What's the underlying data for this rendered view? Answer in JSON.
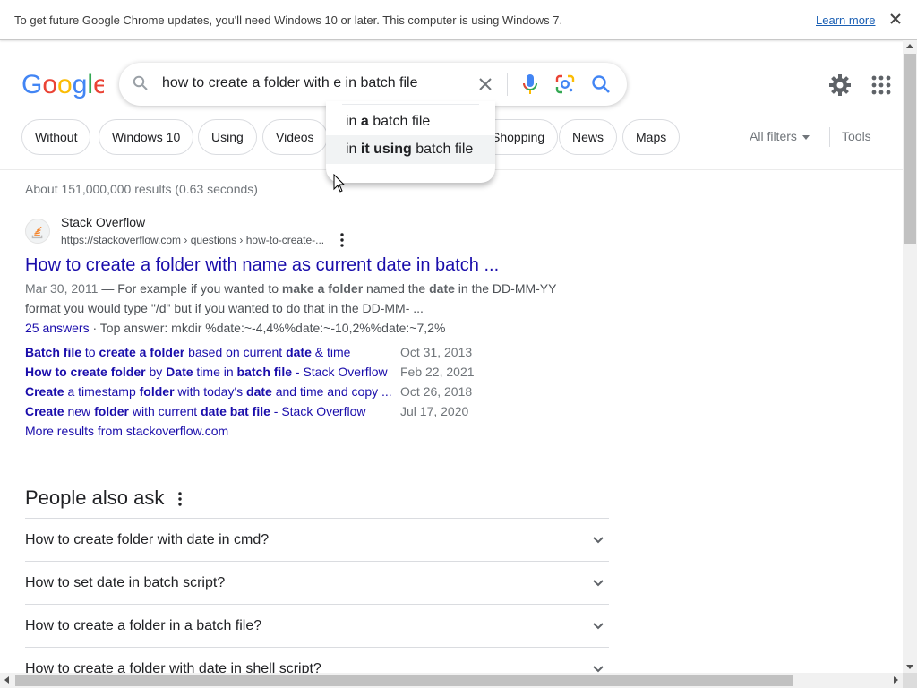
{
  "infobar": {
    "message": "To get future Google Chrome updates, you'll need Windows 10 or later. This computer is using Windows 7.",
    "learn_more": "Learn more"
  },
  "search": {
    "query": "how to create a folder with e in batch file"
  },
  "suggestions": [
    {
      "pre": "in ",
      "bold": "a",
      "post": " batch file"
    },
    {
      "pre": "in ",
      "bold": "it using",
      "post": " batch file"
    }
  ],
  "chips": [
    "Without",
    "Windows 10",
    "Using",
    "Videos",
    "Shopping",
    "News",
    "Maps"
  ],
  "filters": {
    "all_filters": "All filters",
    "tools": "Tools"
  },
  "stats": "About 151,000,000 results (0.63 seconds)",
  "result": {
    "site_name": "Stack Overflow",
    "url": "https://stackoverflow.com › questions › how-to-create-...",
    "title": "How to create a folder with name as current date in batch ...",
    "snippet_line1": {
      "date": "Mar 30, 2011",
      "pre": " — For example if you wanted to ",
      "b1": "make a folder",
      "mid": " named the ",
      "b2": "date",
      "post": " in the DD-MM-YY"
    },
    "snippet_line2": "format you would type \"/d\" but if you wanted to do that in the DD-MM- ...",
    "answers_link": "25 answers",
    "top_answer": " · Top answer: mkdir %date:~-4,4%%date:~-10,2%%date:~7,2%",
    "sublinks": [
      {
        "parts": [
          {
            "t": "Batch file",
            "b": true
          },
          {
            "t": " to ",
            "b": false
          },
          {
            "t": "create a folder",
            "b": true
          },
          {
            "t": " based on current ",
            "b": false
          },
          {
            "t": "date",
            "b": true
          },
          {
            "t": " & time",
            "b": false
          }
        ],
        "date": "Oct 31, 2013"
      },
      {
        "parts": [
          {
            "t": "How to create folder",
            "b": true
          },
          {
            "t": " by ",
            "b": false
          },
          {
            "t": "Date",
            "b": true
          },
          {
            "t": " time in ",
            "b": false
          },
          {
            "t": "batch file",
            "b": true
          },
          {
            "t": " - Stack Overflow",
            "b": false
          }
        ],
        "date": "Feb 22, 2021"
      },
      {
        "parts": [
          {
            "t": "Create",
            "b": true
          },
          {
            "t": " a timestamp ",
            "b": false
          },
          {
            "t": "folder",
            "b": true
          },
          {
            "t": " with today's ",
            "b": false
          },
          {
            "t": "date",
            "b": true
          },
          {
            "t": " and time and copy ...",
            "b": false
          }
        ],
        "date": "Oct 26, 2018"
      },
      {
        "parts": [
          {
            "t": "Create",
            "b": true
          },
          {
            "t": " new ",
            "b": false
          },
          {
            "t": "folder",
            "b": true
          },
          {
            "t": " with current ",
            "b": false
          },
          {
            "t": "date bat file",
            "b": true
          },
          {
            "t": " - Stack Overflow",
            "b": false
          }
        ],
        "date": "Jul 17, 2020"
      }
    ],
    "more_results": "More results from stackoverflow.com"
  },
  "paa": {
    "title": "People also ask",
    "questions": [
      "How to create folder with date in cmd?",
      "How to set date in batch script?",
      "How to create a folder in a batch file?",
      "How to create a folder with date in shell script?"
    ]
  },
  "colors": {
    "link": "#1a0dab",
    "google_blue": "#4285f4",
    "google_red": "#ea4335",
    "google_yellow": "#fbbc05",
    "google_green": "#34a853"
  }
}
